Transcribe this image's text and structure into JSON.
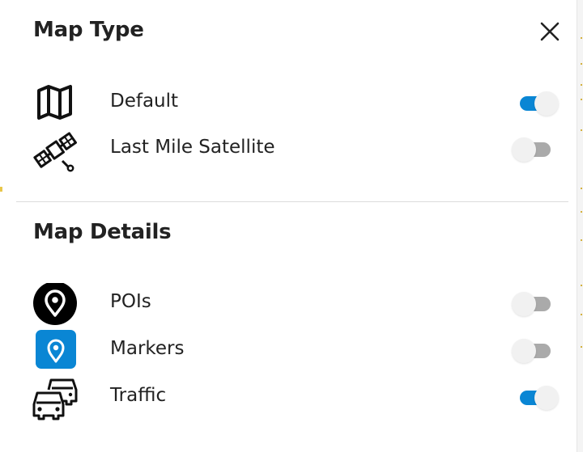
{
  "map_type": {
    "title": "Map Type",
    "items": [
      {
        "label": "Default",
        "icon": "map-icon",
        "enabled": true
      },
      {
        "label": "Last Mile Satellite",
        "icon": "satellite-icon",
        "enabled": false
      }
    ]
  },
  "map_details": {
    "title": "Map Details",
    "items": [
      {
        "label": "POIs",
        "icon": "poi-pin-icon",
        "enabled": false
      },
      {
        "label": "Markers",
        "icon": "marker-pin-icon",
        "enabled": false
      },
      {
        "label": "Traffic",
        "icon": "traffic-cars-icon",
        "enabled": true
      }
    ]
  },
  "colors": {
    "accent": "#0a86d4",
    "toggle_off": "#aaaaaa",
    "divider": "#dcdcdc"
  }
}
